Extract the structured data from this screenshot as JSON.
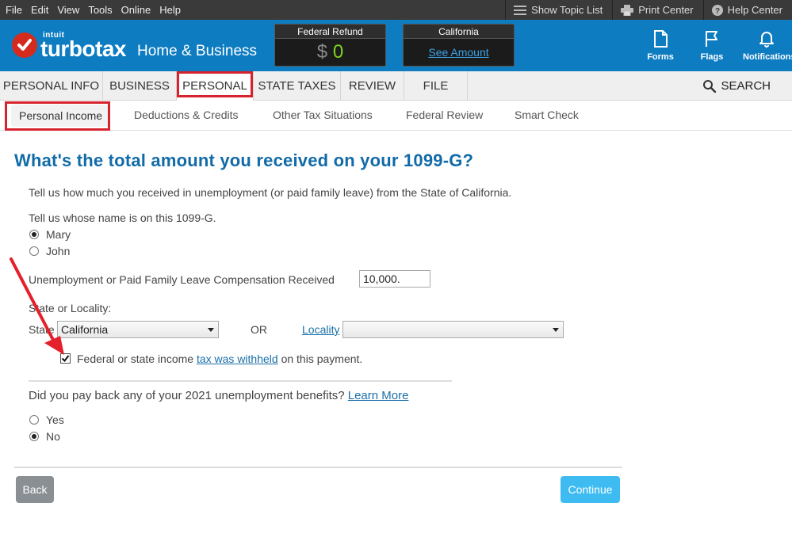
{
  "menu": {
    "items": [
      "File",
      "Edit",
      "View",
      "Tools",
      "Online",
      "Help"
    ],
    "right": [
      {
        "label": "Show Topic List",
        "icon": "list-icon"
      },
      {
        "label": "Print Center",
        "icon": "printer-icon"
      },
      {
        "label": "Help Center",
        "icon": "help-circle-icon"
      }
    ]
  },
  "brand": {
    "intuit": "intuit",
    "turbotax": "turbotax",
    "product": "Home & Business"
  },
  "refund": {
    "federal_title": "Federal Refund",
    "federal_dollar": "$",
    "federal_amount": "0",
    "state_title": "California",
    "state_link": "See Amount"
  },
  "header_icons": {
    "forms": "Forms",
    "flags": "Flags",
    "notifications": "Notifications"
  },
  "main_tabs": [
    "PERSONAL INFO",
    "BUSINESS",
    "PERSONAL",
    "STATE TAXES",
    "REVIEW",
    "FILE"
  ],
  "search_label": "SEARCH",
  "sub_tabs": [
    "Personal Income",
    "Deductions & Credits",
    "Other Tax Situations",
    "Federal Review",
    "Smart Check"
  ],
  "form": {
    "title": "What's the total amount you received on your 1099-G?",
    "intro": "Tell us how much you received in unemployment (or paid family leave) from the State of California.",
    "name_prompt": "Tell us whose name is on this 1099-G.",
    "name_options": [
      "Mary",
      "John"
    ],
    "name_selected": "Mary",
    "amount_label": "Unemployment or Paid Family Leave Compensation Received",
    "amount_value": "10,000.",
    "locality_heading": "State or Locality:",
    "state_label": "State",
    "state_value": "California",
    "or_label": "OR",
    "locality_label": "Locality",
    "locality_value": "",
    "withheld_prefix": "Federal or state income ",
    "withheld_link": "tax was withheld",
    "withheld_suffix": " on this payment.",
    "withheld_checked": true,
    "payback_question": "Did you pay back any of your 2021 unemployment benefits?",
    "learn_more": "Learn More",
    "payback_options": [
      "Yes",
      "No"
    ],
    "payback_selected": "No"
  },
  "buttons": {
    "back": "Back",
    "continue": "Continue"
  },
  "colors": {
    "header_blue": "#0d7cc1",
    "highlight_red": "#d6232e",
    "continue_blue": "#3ebcf2",
    "refund_green": "#7ed321",
    "title_blue": "#116ba8"
  }
}
